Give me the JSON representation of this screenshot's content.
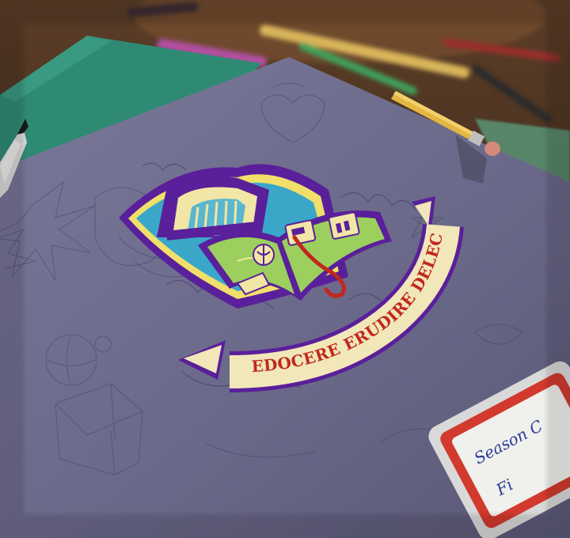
{
  "scene": {
    "motto": "EDOCERE ERUDIRE DELECTARE",
    "label_card_text": [
      "Season C",
      "Fi"
    ],
    "colors": {
      "desk": "#4a3424",
      "folder_green": "#2f8a74",
      "paper": "#6f6d8e",
      "crest_purple": "#5a1f9a",
      "crest_teal": "#3aa7c9",
      "crest_yellow": "#f0df6a",
      "book_green": "#9ccf5e",
      "ribbon_cream": "#f1e7b8",
      "motto_red": "#c0281f",
      "label_red": "#d23a2e"
    }
  }
}
